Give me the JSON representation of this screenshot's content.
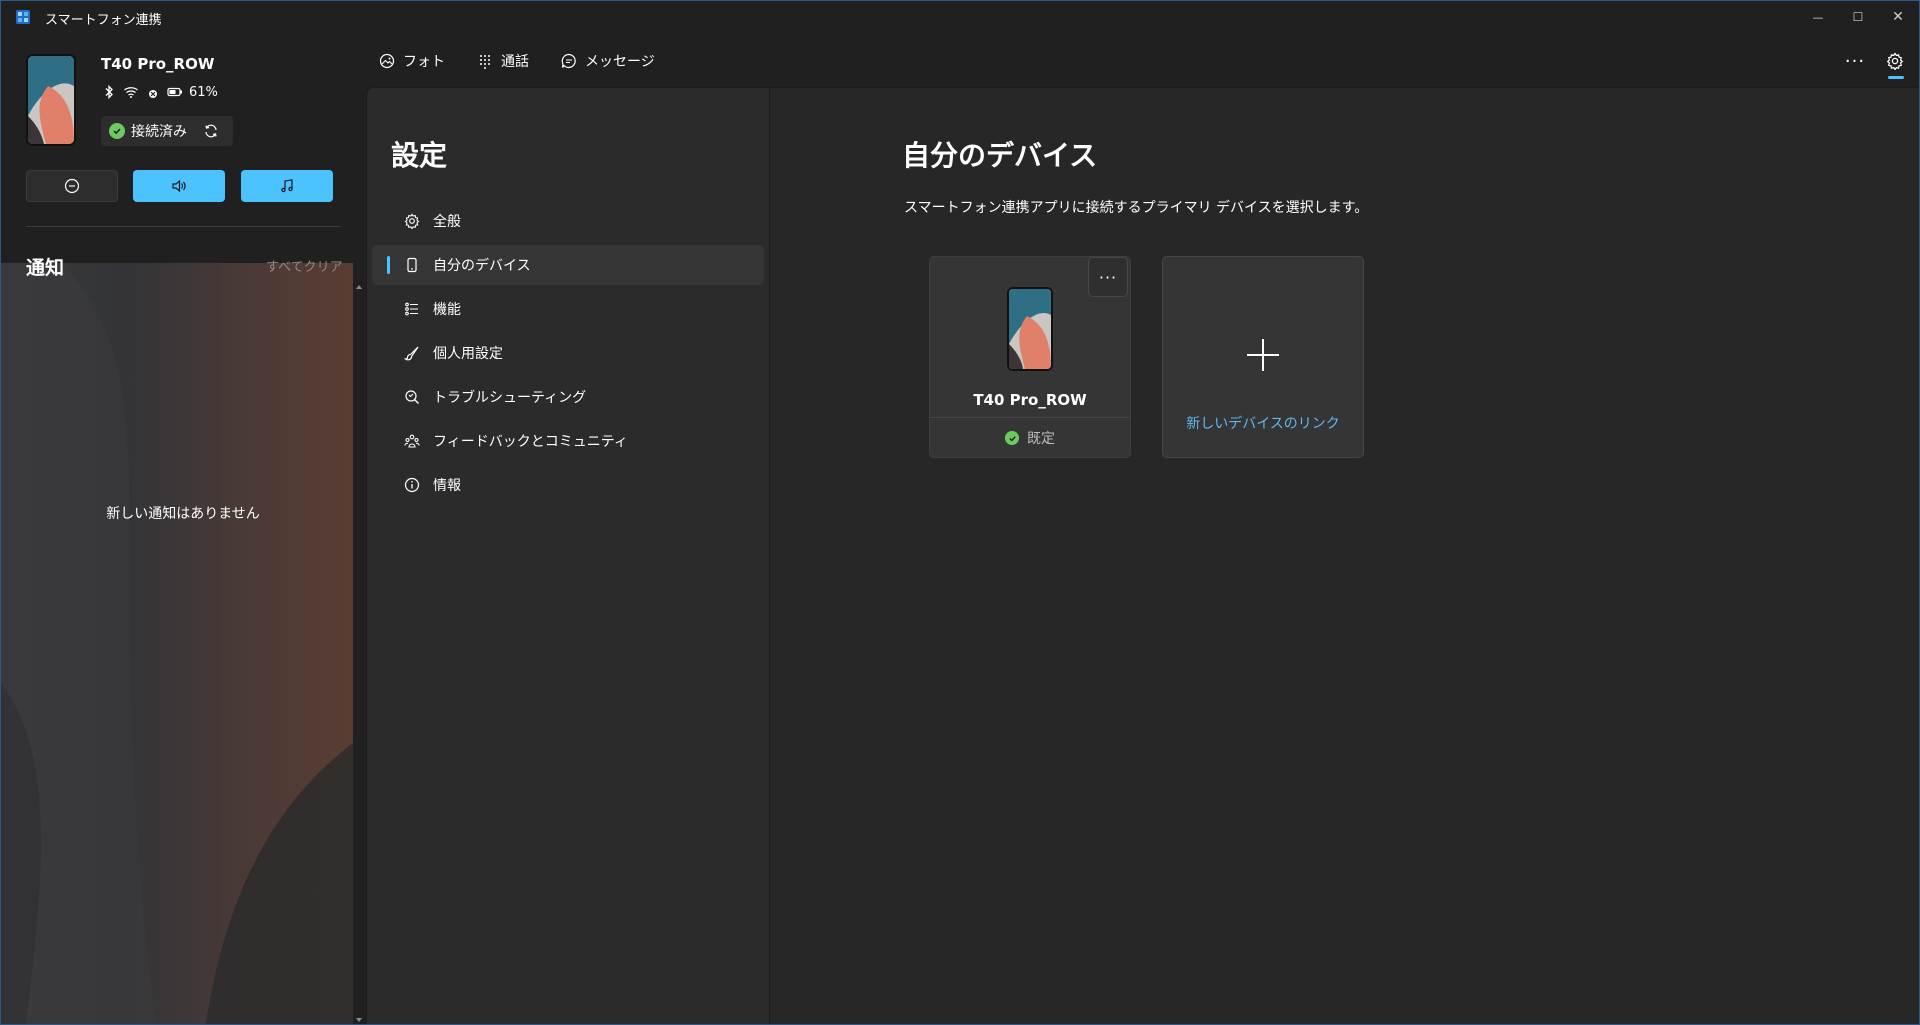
{
  "window": {
    "title": "スマートフォン連携",
    "controls": {
      "minimize": "—",
      "maximize": "☐",
      "close": "✕"
    }
  },
  "device": {
    "name": "T40 Pro_ROW",
    "battery": "61%",
    "connection": "接続済み"
  },
  "quick_actions": [
    {
      "icon": "do-not-disturb-icon",
      "active": false
    },
    {
      "icon": "volume-icon",
      "active": true
    },
    {
      "icon": "music-icon",
      "active": true
    }
  ],
  "notifications": {
    "title": "通知",
    "clear_all": "すべてクリア",
    "empty_text": "新しい通知はありません"
  },
  "topnav": {
    "items": [
      {
        "label": "フォト",
        "icon": "photo-icon"
      },
      {
        "label": "通話",
        "icon": "dialpad-icon"
      },
      {
        "label": "メッセージ",
        "icon": "message-icon"
      }
    ],
    "more": "···"
  },
  "settings": {
    "title": "設定",
    "items": [
      {
        "label": "全般",
        "icon": "gear-icon"
      },
      {
        "label": "自分のデバイス",
        "icon": "phone-icon"
      },
      {
        "label": "機能",
        "icon": "list-icon"
      },
      {
        "label": "個人用設定",
        "icon": "brush-icon"
      },
      {
        "label": "トラブルシューティング",
        "icon": "troubleshoot-icon"
      },
      {
        "label": "フィードバックとコミュニティ",
        "icon": "community-icon"
      },
      {
        "label": "情報",
        "icon": "info-icon"
      }
    ],
    "active_index": 1
  },
  "page": {
    "title": "自分のデバイス",
    "description": "スマートフォン連携アプリに接続するプライマリ デバイスを選択します。",
    "device_card": {
      "name": "T40 Pro_ROW",
      "status": "既定",
      "more": "···"
    },
    "add_card": {
      "label": "新しいデバイスのリンク"
    }
  },
  "colors": {
    "accent": "#4cc2ff",
    "success": "#6ccb5f",
    "link": "#60b8ee",
    "background": "#202020",
    "content": "#272727",
    "nav_panel": "#2b2b2b"
  }
}
